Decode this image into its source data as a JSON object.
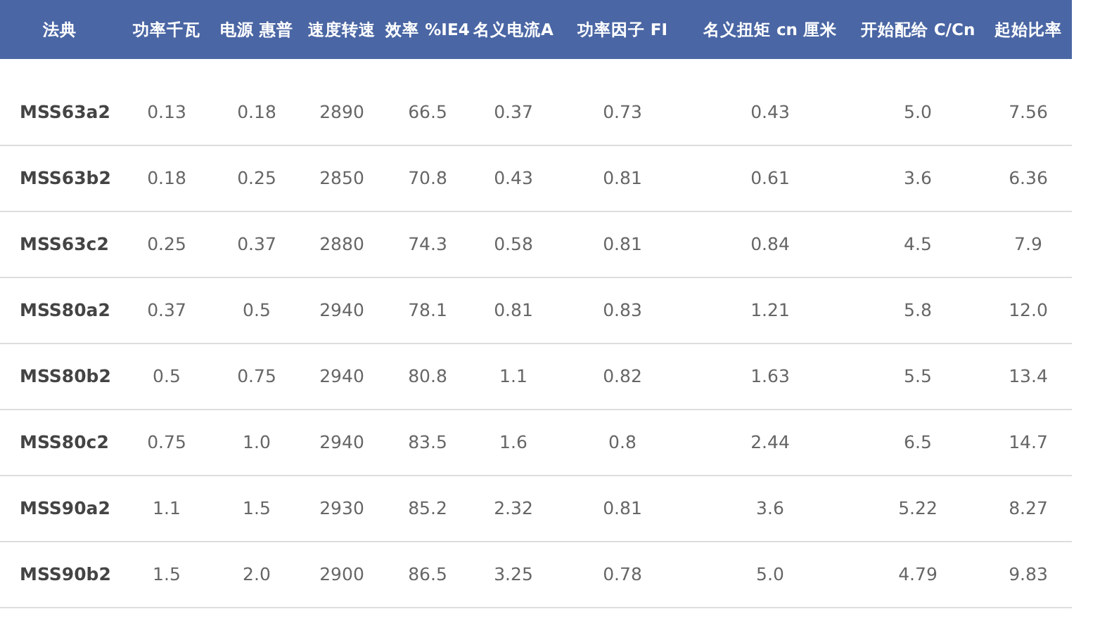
{
  "table": {
    "columns": [
      "法典",
      "功率千瓦",
      "电源 惠普",
      "速度转速",
      "效率 %IE4",
      "名义电流A",
      "功率因子 FI",
      "名义扭矩 cn 厘米",
      "开始配给 C/Cn",
      "起始比率"
    ],
    "rows": [
      [
        "MSS63a2",
        "0.13",
        "0.18",
        "2890",
        "66.5",
        "0.37",
        "0.73",
        "0.43",
        "5.0",
        "7.56"
      ],
      [
        "MSS63b2",
        "0.18",
        "0.25",
        "2850",
        "70.8",
        "0.43",
        "0.81",
        "0.61",
        "3.6",
        "6.36"
      ],
      [
        "MSS63c2",
        "0.25",
        "0.37",
        "2880",
        "74.3",
        "0.58",
        "0.81",
        "0.84",
        "4.5",
        "7.9"
      ],
      [
        "MSS80a2",
        "0.37",
        "0.5",
        "2940",
        "78.1",
        "0.81",
        "0.83",
        "1.21",
        "5.8",
        "12.0"
      ],
      [
        "MSS80b2",
        "0.5",
        "0.75",
        "2940",
        "80.8",
        "1.1",
        "0.82",
        "1.63",
        "5.5",
        "13.4"
      ],
      [
        "MSS80c2",
        "0.75",
        "1.0",
        "2940",
        "83.5",
        "1.6",
        "0.8",
        "2.44",
        "6.5",
        "14.7"
      ],
      [
        "MSS90a2",
        "1.1",
        "1.5",
        "2930",
        "85.2",
        "2.32",
        "0.81",
        "3.6",
        "5.22",
        "8.27"
      ],
      [
        "MSS90b2",
        "1.5",
        "2.0",
        "2900",
        "86.5",
        "3.25",
        "0.78",
        "5.0",
        "4.79",
        "9.83"
      ]
    ]
  }
}
